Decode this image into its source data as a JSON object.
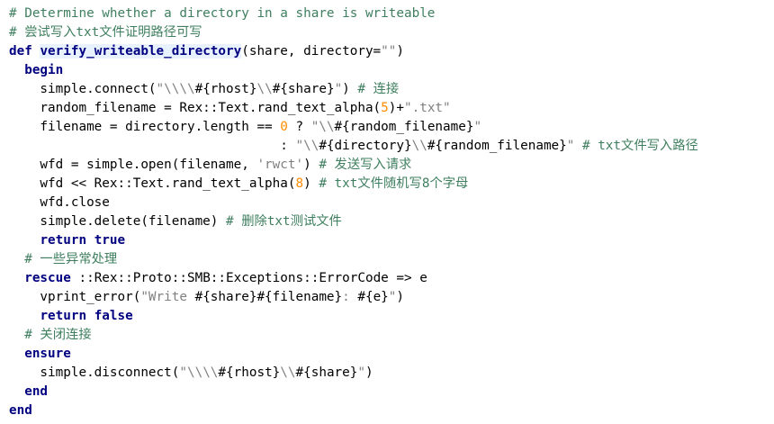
{
  "editor": {
    "colors": {
      "background": "#ffffff",
      "comment": "#3f7f5f",
      "keyword": "#000080",
      "number": "#ff8c00",
      "string": "#808080",
      "plain": "#000000",
      "function_highlight_bg": "#e8f2fe"
    },
    "lines": [
      [
        {
          "t": "comment",
          "v": "# Determine whether a directory in a share is writeable"
        }
      ],
      [
        {
          "t": "comment",
          "v": "# 尝试写入txt文件证明路径可写"
        }
      ],
      [
        {
          "t": "keyword",
          "v": "def"
        },
        {
          "t": "plain",
          "v": " "
        },
        {
          "t": "fn",
          "v": "verify_writeable_directory"
        },
        {
          "t": "plain",
          "v": "(share, directory="
        },
        {
          "t": "string",
          "v": "\"\""
        },
        {
          "t": "plain",
          "v": ")"
        }
      ],
      [
        {
          "t": "plain",
          "v": "  "
        },
        {
          "t": "keyword",
          "v": "begin"
        }
      ],
      [
        {
          "t": "plain",
          "v": "    simple.connect("
        },
        {
          "t": "string",
          "v": "\"\\\\\\\\"
        },
        {
          "t": "interp",
          "v": "#{rhost}"
        },
        {
          "t": "string",
          "v": "\\\\"
        },
        {
          "t": "interp",
          "v": "#{share}"
        },
        {
          "t": "string",
          "v": "\""
        },
        {
          "t": "plain",
          "v": ") "
        },
        {
          "t": "comment",
          "v": "# 连接"
        }
      ],
      [
        {
          "t": "plain",
          "v": "    random_filename = Rex::Text.rand_text_alpha("
        },
        {
          "t": "number",
          "v": "5"
        },
        {
          "t": "plain",
          "v": ")+"
        },
        {
          "t": "string",
          "v": "\".txt\""
        }
      ],
      [
        {
          "t": "plain",
          "v": "    filename = directory.length == "
        },
        {
          "t": "number",
          "v": "0"
        },
        {
          "t": "plain",
          "v": " ? "
        },
        {
          "t": "string",
          "v": "\"\\\\"
        },
        {
          "t": "interp",
          "v": "#{random_filename}"
        },
        {
          "t": "string",
          "v": "\""
        }
      ],
      [
        {
          "t": "plain",
          "v": "                                   : "
        },
        {
          "t": "string",
          "v": "\"\\\\"
        },
        {
          "t": "interp",
          "v": "#{directory}"
        },
        {
          "t": "string",
          "v": "\\\\"
        },
        {
          "t": "interp",
          "v": "#{random_filename}"
        },
        {
          "t": "string",
          "v": "\""
        },
        {
          "t": "plain",
          "v": " "
        },
        {
          "t": "comment",
          "v": "# txt文件写入路径"
        }
      ],
      [
        {
          "t": "plain",
          "v": "    wfd = simple.open(filename, "
        },
        {
          "t": "string",
          "v": "'rwct'"
        },
        {
          "t": "plain",
          "v": ") "
        },
        {
          "t": "comment",
          "v": "# 发送写入请求"
        }
      ],
      [
        {
          "t": "plain",
          "v": "    wfd << Rex::Text.rand_text_alpha("
        },
        {
          "t": "number",
          "v": "8"
        },
        {
          "t": "plain",
          "v": ") "
        },
        {
          "t": "comment",
          "v": "# txt文件随机写8个字母"
        }
      ],
      [
        {
          "t": "plain",
          "v": "    wfd.close"
        }
      ],
      [
        {
          "t": "plain",
          "v": "    simple.delete(filename) "
        },
        {
          "t": "comment",
          "v": "# 删除txt测试文件"
        }
      ],
      [
        {
          "t": "plain",
          "v": "    "
        },
        {
          "t": "keyword",
          "v": "return"
        },
        {
          "t": "plain",
          "v": " "
        },
        {
          "t": "keyword",
          "v": "true"
        }
      ],
      [
        {
          "t": "plain",
          "v": "  "
        },
        {
          "t": "comment",
          "v": "# 一些异常处理"
        }
      ],
      [
        {
          "t": "plain",
          "v": "  "
        },
        {
          "t": "keyword",
          "v": "rescue"
        },
        {
          "t": "plain",
          "v": " ::Rex::Proto::SMB::Exceptions::ErrorCode => e"
        }
      ],
      [
        {
          "t": "plain",
          "v": "    vprint_error("
        },
        {
          "t": "string",
          "v": "\"Write "
        },
        {
          "t": "interp",
          "v": "#{share}#{filename}"
        },
        {
          "t": "string",
          "v": ": "
        },
        {
          "t": "interp",
          "v": "#{e}"
        },
        {
          "t": "string",
          "v": "\""
        },
        {
          "t": "plain",
          "v": ")"
        }
      ],
      [
        {
          "t": "plain",
          "v": "    "
        },
        {
          "t": "keyword",
          "v": "return"
        },
        {
          "t": "plain",
          "v": " "
        },
        {
          "t": "keyword",
          "v": "false"
        }
      ],
      [
        {
          "t": "plain",
          "v": "  "
        },
        {
          "t": "comment",
          "v": "# 关闭连接"
        }
      ],
      [
        {
          "t": "plain",
          "v": "  "
        },
        {
          "t": "keyword",
          "v": "ensure"
        }
      ],
      [
        {
          "t": "plain",
          "v": "    simple.disconnect("
        },
        {
          "t": "string",
          "v": "\"\\\\\\\\"
        },
        {
          "t": "interp",
          "v": "#{rhost}"
        },
        {
          "t": "string",
          "v": "\\\\"
        },
        {
          "t": "interp",
          "v": "#{share}"
        },
        {
          "t": "string",
          "v": "\""
        },
        {
          "t": "plain",
          "v": ")"
        }
      ],
      [
        {
          "t": "plain",
          "v": "  "
        },
        {
          "t": "keyword",
          "v": "end"
        }
      ],
      [
        {
          "t": "keyword",
          "v": "end"
        }
      ]
    ]
  }
}
